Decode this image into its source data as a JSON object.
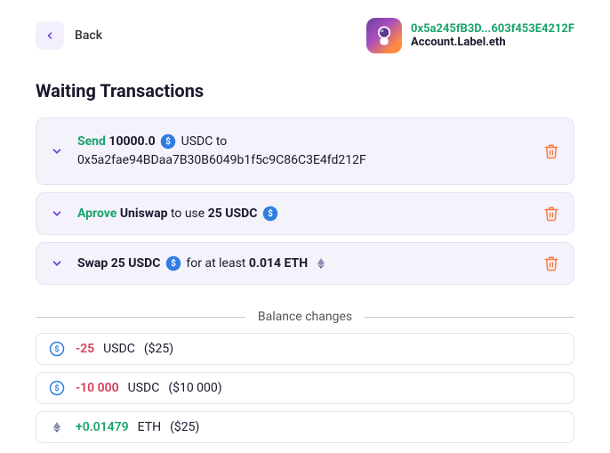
{
  "header": {
    "back_label": "Back",
    "account_address_short": "0x5a245fB3D...603f453E4212F",
    "account_label": "Account.Label.eth"
  },
  "page_title": "Waiting Transactions",
  "tx": {
    "t0": {
      "action": "Send",
      "amount": "10000.0",
      "token": "USDC",
      "suffix": "to",
      "recipient": "0x5a2fae94BDaa7B30B6049b1f5c9C86C3E4fd212F"
    },
    "t1": {
      "action": "Aprove",
      "counterparty": "Uniswap",
      "mid": "to use",
      "amount": "25 USDC"
    },
    "t2": {
      "action": "Swap",
      "amount_in": "25 USDC",
      "mid": "for at least",
      "amount_out": "0.014 ETH"
    }
  },
  "balance_label": "Balance changes",
  "balance": {
    "b0": {
      "amount": "-25",
      "token": "USDC",
      "fiat": "($25)"
    },
    "b1": {
      "amount": "-10 000",
      "token": "USDC",
      "fiat": "($10 000)"
    },
    "b2": {
      "amount": "+0.01479",
      "token": "ETH",
      "fiat": "($25)"
    }
  }
}
